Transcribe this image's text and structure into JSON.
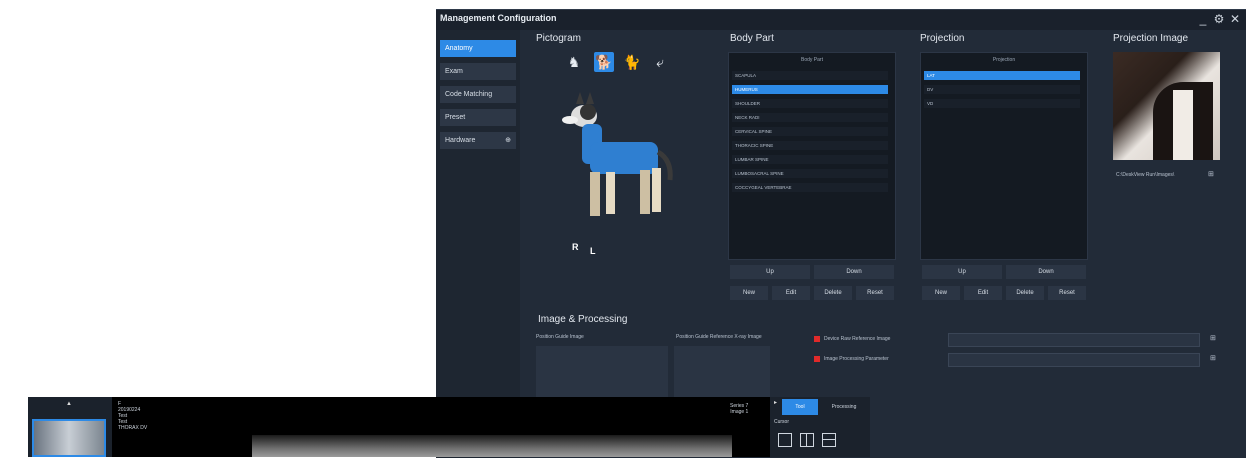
{
  "window": {
    "title": "Management Configuration",
    "controls": {
      "minimize": "_",
      "settings": "⚙",
      "close": "✕"
    }
  },
  "sidebar": {
    "items": [
      {
        "label": "Anatomy",
        "active": true
      },
      {
        "label": "Exam"
      },
      {
        "label": "Code Matching"
      },
      {
        "label": "Preset"
      },
      {
        "label": "Hardware",
        "badge": "⊕"
      }
    ]
  },
  "pictogram": {
    "title": "Pictogram",
    "icons": [
      "horse-icon",
      "dog-icon",
      "cat-icon",
      "bird-icon"
    ],
    "labels": {
      "right": "R",
      "left": "L"
    }
  },
  "body_part": {
    "title": "Body Part",
    "header": "Body Part",
    "items": [
      "SCAPULA",
      "HUMERUS",
      "SHOULDER",
      "NECK RADI",
      "CERVICAL SPINE",
      "THORACIC SPINE",
      "LUMBAR SPINE",
      "LUMBOSACRAL SPINE",
      "COCCYGEAL VERTEBRAE"
    ],
    "selected_index": 1,
    "buttons": {
      "up": "Up",
      "down": "Down",
      "new": "New",
      "edit": "Edit",
      "delete": "Delete",
      "reset": "Reset"
    }
  },
  "projection": {
    "title": "Projection",
    "header": "Projection",
    "items": [
      "LAT",
      "DV",
      "VD"
    ],
    "selected_index": 0,
    "buttons": {
      "up": "Up",
      "down": "Down",
      "new": "New",
      "edit": "Edit",
      "delete": "Delete",
      "reset": "Reset"
    }
  },
  "projection_image": {
    "title": "Projection Image",
    "path": "C:\\DeskView Run\\Images\\"
  },
  "processing": {
    "title": "Image & Processing",
    "position_guide_label": "Position Guide Image",
    "position_guide_ref_label": "Position Guide Reference X-ray Image",
    "device_raw_label": "Device Raw Reference Image",
    "image_processing_label": "Image Processing Parameter"
  },
  "viewer": {
    "up_arrow": "▲",
    "patient_lines": [
      "F",
      "20190224",
      "Test",
      "Test",
      "THORAX DV"
    ],
    "series": "Series 7",
    "image": "Image 1",
    "tabs": [
      "Tool",
      "Processing"
    ],
    "cursor_label": "Cursor"
  },
  "colors": {
    "accent": "#2d8ae6",
    "background": "#222b38",
    "warning": "#e02a2a"
  }
}
